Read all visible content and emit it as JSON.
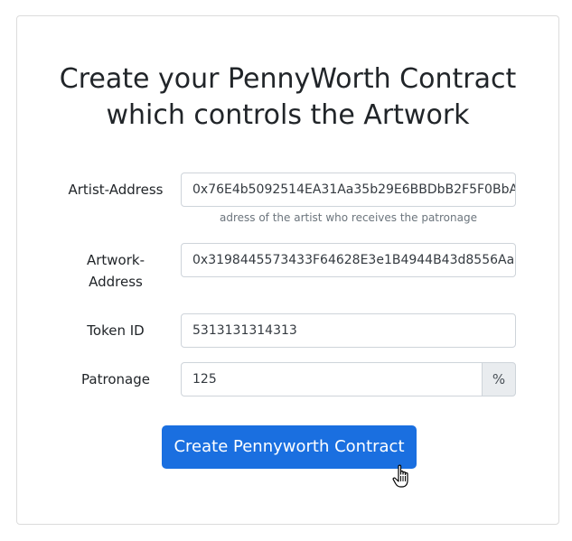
{
  "title": {
    "line1": "Create your PennyWorth Contract",
    "line2": "which controls the Artwork"
  },
  "form": {
    "artist_address": {
      "label": "Artist-Address",
      "value": "0x76E4b5092514EA31Aa35b29E6BBDbB2F5F0BbA",
      "help": "adress of the artist who receives the patronage"
    },
    "artwork_address": {
      "label_line1": "Artwork-",
      "label_line2": "Address",
      "value": "0x3198445573433F64628E3e1B4944B43d8556Aa"
    },
    "token_id": {
      "label": "Token ID",
      "value": "5313131314313"
    },
    "patronage": {
      "label": "Patronage",
      "value": "125",
      "suffix": "%"
    },
    "submit_label": "Create Pennyworth Contract"
  },
  "colors": {
    "primary": "#1a6fe0",
    "addon_bg": "#e9ecef",
    "border": "#ced4da",
    "help_text": "#6c757d"
  },
  "icons": {
    "cursor": "hand-pointer-icon"
  }
}
